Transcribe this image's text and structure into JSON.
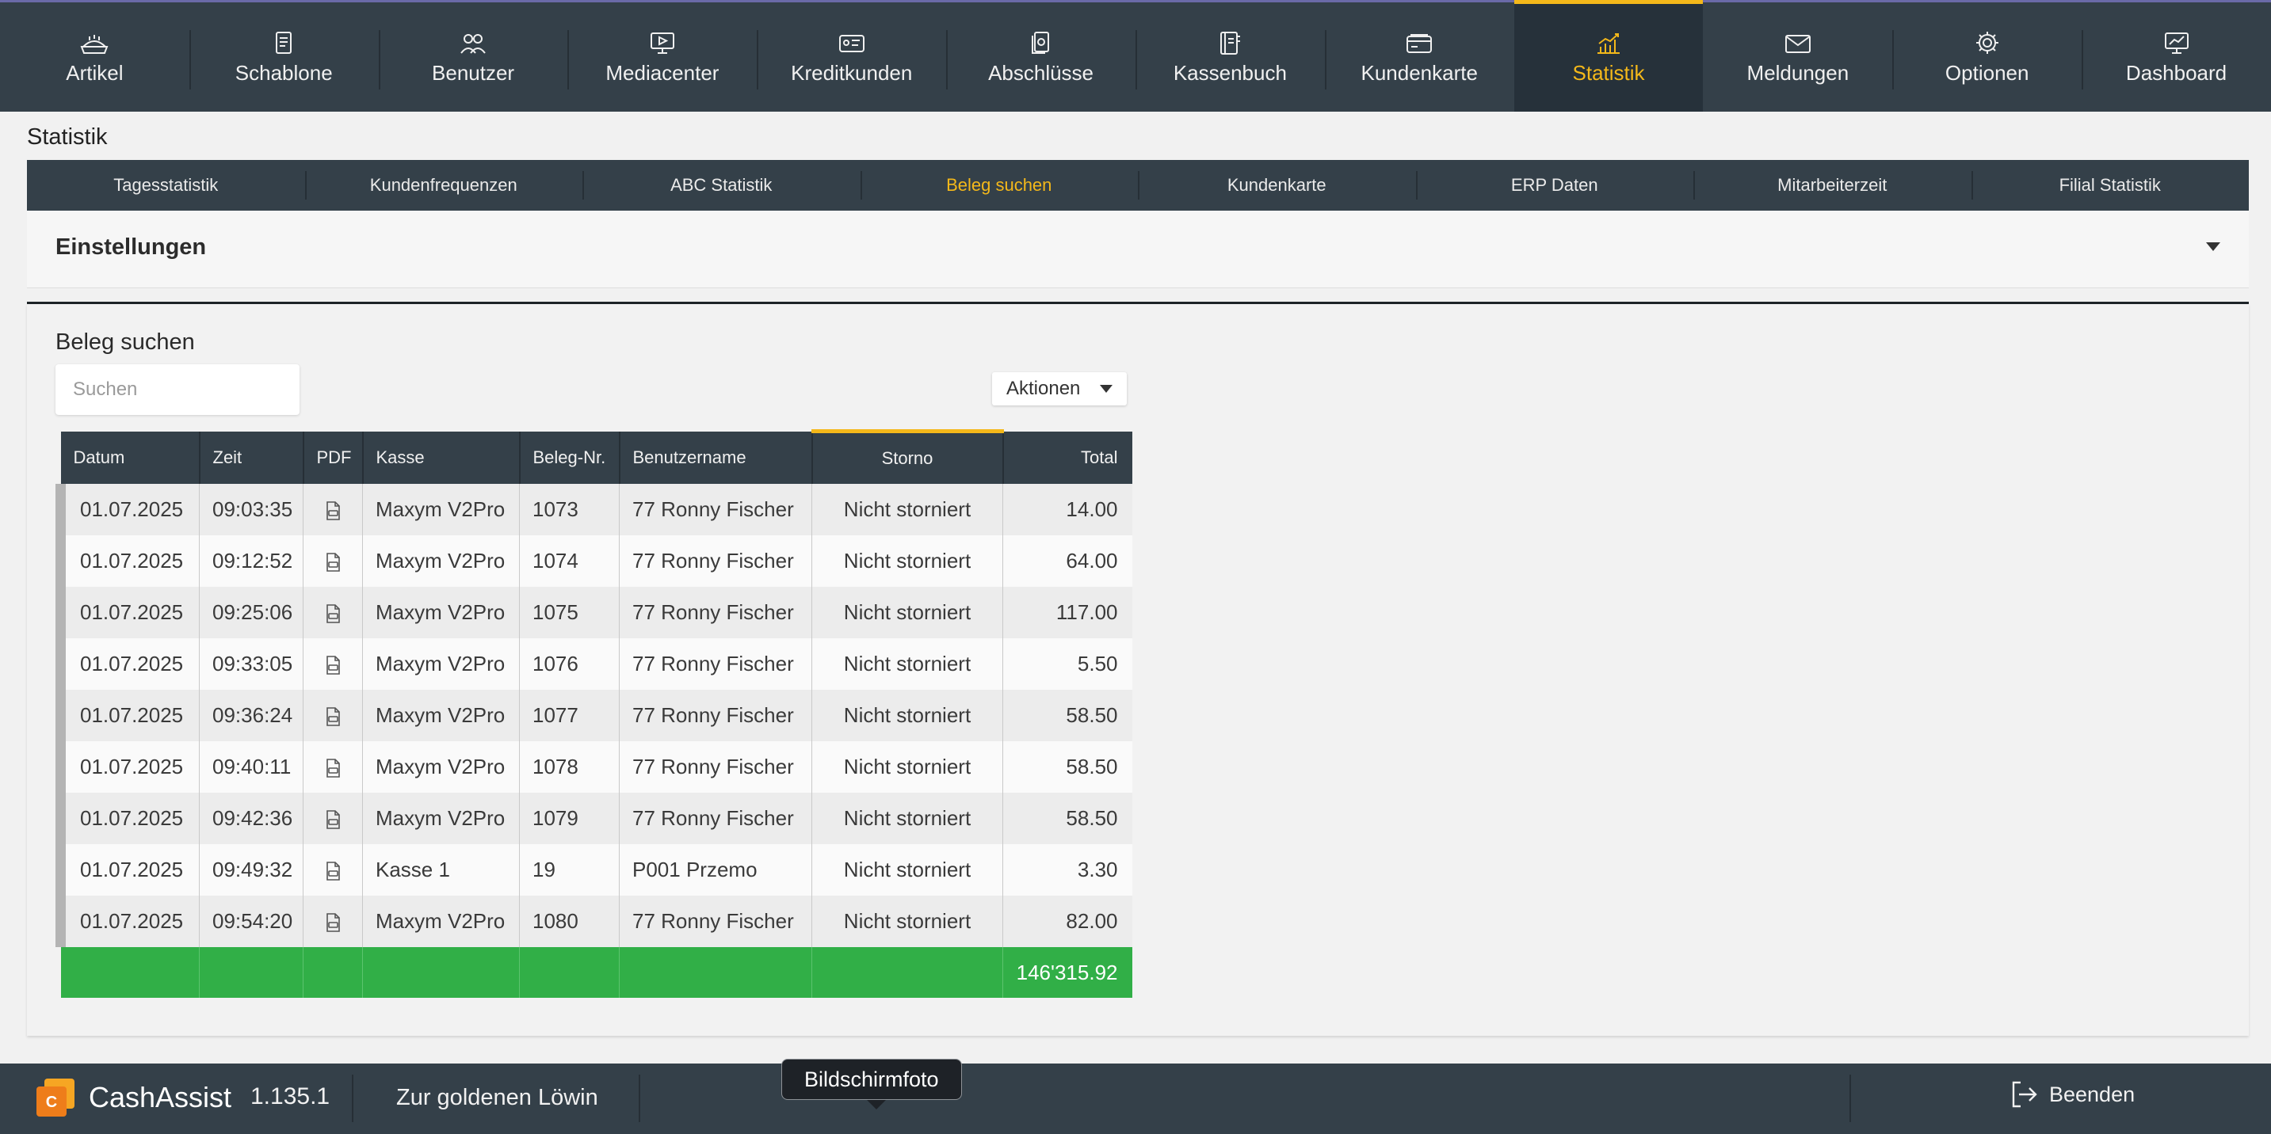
{
  "nav": {
    "items": [
      {
        "label": "Artikel",
        "icon": "bread-basket-icon"
      },
      {
        "label": "Schablone",
        "icon": "template-icon"
      },
      {
        "label": "Benutzer",
        "icon": "users-icon"
      },
      {
        "label": "Mediacenter",
        "icon": "monitor-media-icon"
      },
      {
        "label": "Kreditkunden",
        "icon": "id-card-icon"
      },
      {
        "label": "Abschlüsse",
        "icon": "documents-icon"
      },
      {
        "label": "Kassenbuch",
        "icon": "cash-book-icon"
      },
      {
        "label": "Kundenkarte",
        "icon": "wallet-card-icon"
      },
      {
        "label": "Statistik",
        "icon": "chart-icon",
        "active": true
      },
      {
        "label": "Meldungen",
        "icon": "envelope-icon"
      },
      {
        "label": "Optionen",
        "icon": "gear-icon"
      },
      {
        "label": "Dashboard",
        "icon": "dashboard-monitor-icon"
      }
    ],
    "active_color": "#f4b81a"
  },
  "page": {
    "title": "Statistik"
  },
  "subtabs": [
    {
      "label": "Tagesstatistik"
    },
    {
      "label": "Kundenfrequenzen"
    },
    {
      "label": "ABC Statistik"
    },
    {
      "label": "Beleg suchen",
      "active": true
    },
    {
      "label": "Kundenkarte"
    },
    {
      "label": "ERP Daten"
    },
    {
      "label": "Mitarbeiterzeit"
    },
    {
      "label": "Filial Statistik"
    }
  ],
  "settings": {
    "title": "Einstellungen"
  },
  "receipt_search": {
    "title": "Beleg suchen",
    "search_placeholder": "Suchen",
    "actions_label": "Aktionen",
    "columns": [
      "Datum",
      "Zeit",
      "PDF",
      "Kasse",
      "Beleg-Nr.",
      "Benutzername",
      "Storno",
      "Total"
    ],
    "sorted_column": "Storno",
    "rows": [
      {
        "date": "01.07.2025",
        "time": "09:03:35",
        "register": "Maxym V2Pro",
        "receipt_no": "1073",
        "user": "77 Ronny Fischer",
        "storno": "Nicht storniert",
        "total": "14.00"
      },
      {
        "date": "01.07.2025",
        "time": "09:12:52",
        "register": "Maxym V2Pro",
        "receipt_no": "1074",
        "user": "77 Ronny Fischer",
        "storno": "Nicht storniert",
        "total": "64.00"
      },
      {
        "date": "01.07.2025",
        "time": "09:25:06",
        "register": "Maxym V2Pro",
        "receipt_no": "1075",
        "user": "77 Ronny Fischer",
        "storno": "Nicht storniert",
        "total": "117.00"
      },
      {
        "date": "01.07.2025",
        "time": "09:33:05",
        "register": "Maxym V2Pro",
        "receipt_no": "1076",
        "user": "77 Ronny Fischer",
        "storno": "Nicht storniert",
        "total": "5.50"
      },
      {
        "date": "01.07.2025",
        "time": "09:36:24",
        "register": "Maxym V2Pro",
        "receipt_no": "1077",
        "user": "77 Ronny Fischer",
        "storno": "Nicht storniert",
        "total": "58.50"
      },
      {
        "date": "01.07.2025",
        "time": "09:40:11",
        "register": "Maxym V2Pro",
        "receipt_no": "1078",
        "user": "77 Ronny Fischer",
        "storno": "Nicht storniert",
        "total": "58.50"
      },
      {
        "date": "01.07.2025",
        "time": "09:42:36",
        "register": "Maxym V2Pro",
        "receipt_no": "1079",
        "user": "77 Ronny Fischer",
        "storno": "Nicht storniert",
        "total": "58.50"
      },
      {
        "date": "01.07.2025",
        "time": "09:49:32",
        "register": "Kasse 1",
        "receipt_no": "19",
        "user": "P001 Przemo",
        "storno": "Nicht storniert",
        "total": "3.30"
      },
      {
        "date": "01.07.2025",
        "time": "09:54:20",
        "register": "Maxym V2Pro",
        "receipt_no": "1080",
        "user": "77 Ronny Fischer",
        "storno": "Nicht storniert",
        "total": "82.00"
      }
    ],
    "grand_total": "146'315.92",
    "total_row_color": "#31af47"
  },
  "footer": {
    "brand": "CashAssist",
    "version": "1.135.1",
    "store": "Zur goldenen Löwin",
    "tooltip": "Bildschirmfoto",
    "exit_label": "Beenden"
  }
}
